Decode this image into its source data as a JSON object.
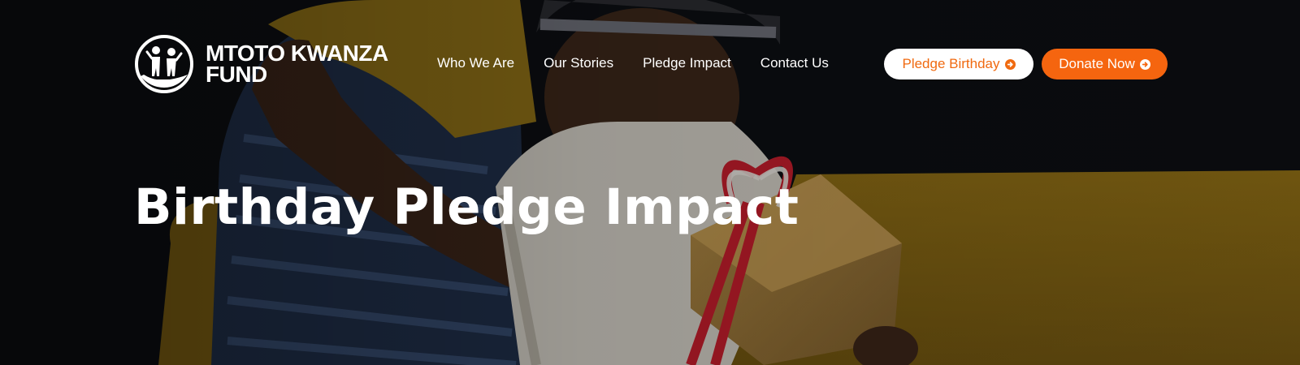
{
  "brand": {
    "name_line1": "MTOTO KWANZA",
    "name_line2": "FUND",
    "logo_icon": "children-in-hand-icon"
  },
  "nav": {
    "items": [
      {
        "label": "Who We Are"
      },
      {
        "label": "Our Stories"
      },
      {
        "label": "Pledge Impact"
      },
      {
        "label": "Contact Us"
      }
    ]
  },
  "actions": {
    "pledge_label": "Pledge Birthday",
    "donate_label": "Donate Now",
    "arrow_icon": "arrow-right-circle-icon"
  },
  "hero": {
    "title": "Birthday Pledge Impact",
    "image_subject": "photo-children-hug-gift"
  },
  "colors": {
    "accent_orange": "#f5650f",
    "text_white": "#ffffff",
    "sofa_mustard": "#b8901e",
    "background_dark": "#0d0f12"
  }
}
